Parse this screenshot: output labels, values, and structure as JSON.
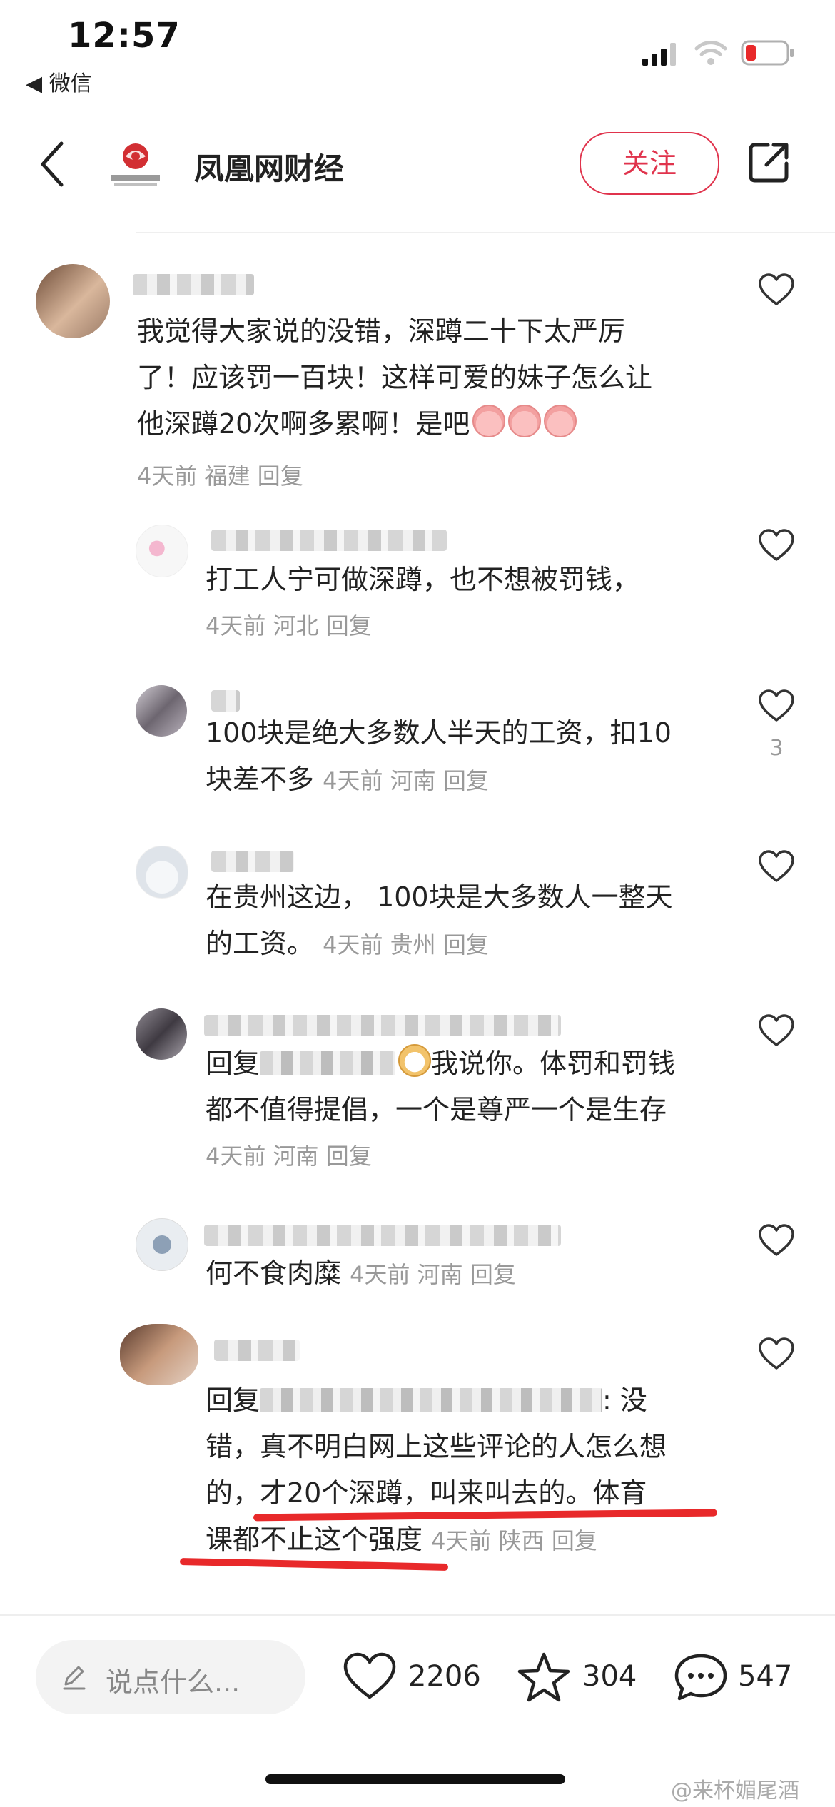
{
  "status_bar": {
    "time": "12:57",
    "back_app": "◀ 微信"
  },
  "header": {
    "title": "凤凰网财经",
    "follow_label": "关注"
  },
  "comments": [
    {
      "lines": [
        "我觉得大家说的没错，深蹲二十下太严厉",
        "了！应该罚一百块！这样可爱的妹子怎么让",
        "他深蹲20次啊多累啊！是吧"
      ],
      "meta": "4天前 福建 回复"
    },
    {
      "lines": [
        "打工人宁可做深蹲，也不想被罚钱，"
      ],
      "meta": "4天前 河北 回复"
    },
    {
      "lines": [
        "100块是绝大多数人半天的工资，扣10",
        "块差不多"
      ],
      "meta": "4天前 河南 回复",
      "like_count": "3"
    },
    {
      "lines": [
        "在贵州这边， 100块是大多数人一整天",
        "的工资。"
      ],
      "meta": "4天前 贵州 回复"
    },
    {
      "reply_prefix": "回复",
      "lines": [
        "我说你。体罚和罚钱",
        "都不值得提倡，一个是尊严一个是生存"
      ],
      "meta": "4天前 河南 回复"
    },
    {
      "lines": [
        "何不食肉糜"
      ],
      "meta": "4天前 河南 回复"
    },
    {
      "reply_prefix": "回复",
      "lines": [
        ": 没",
        "错，真不明白网上这些评论的人怎么想",
        "的，才20个深蹲，叫来叫去的。体育",
        "课都不止这个强度"
      ],
      "meta": "4天前 陕西 回复"
    }
  ],
  "bottom_bar": {
    "input_placeholder": "说点什么...",
    "like_count": "2206",
    "favorite_count": "304",
    "comment_count": "547"
  },
  "watermark": "@来杯媚尾酒",
  "colors": {
    "accent": "#e0334c",
    "underline": "#e8292a",
    "meta": "#999999"
  }
}
